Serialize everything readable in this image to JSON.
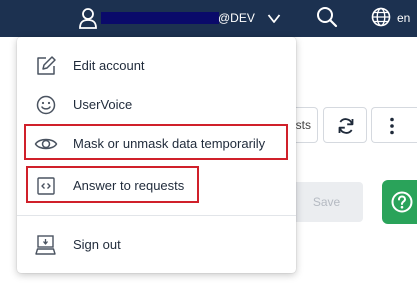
{
  "header": {
    "env_suffix": "@DEV",
    "lang_code": "en",
    "bg_color": "#1c3150",
    "icons": [
      "user-icon",
      "chevron-down-icon",
      "search-icon",
      "globe-icon"
    ]
  },
  "toolbar": {
    "partial_button_label": "sts",
    "save_label": "Save",
    "icons": [
      "refresh-icon",
      "more-vertical-icon",
      "help-icon"
    ],
    "help_color": "#2aa35a"
  },
  "user_menu": {
    "items": [
      {
        "label": "Edit account",
        "icon": "edit-icon"
      },
      {
        "label": "UserVoice",
        "icon": "smiley-icon"
      },
      {
        "label": "Mask or unmask data temporarily",
        "icon": "eye-icon"
      },
      {
        "label": "Answer to requests",
        "icon": "code-window-icon"
      },
      {
        "label": "Sign out",
        "icon": "sign-out-icon"
      }
    ],
    "highlight_color": "#d0202a"
  }
}
